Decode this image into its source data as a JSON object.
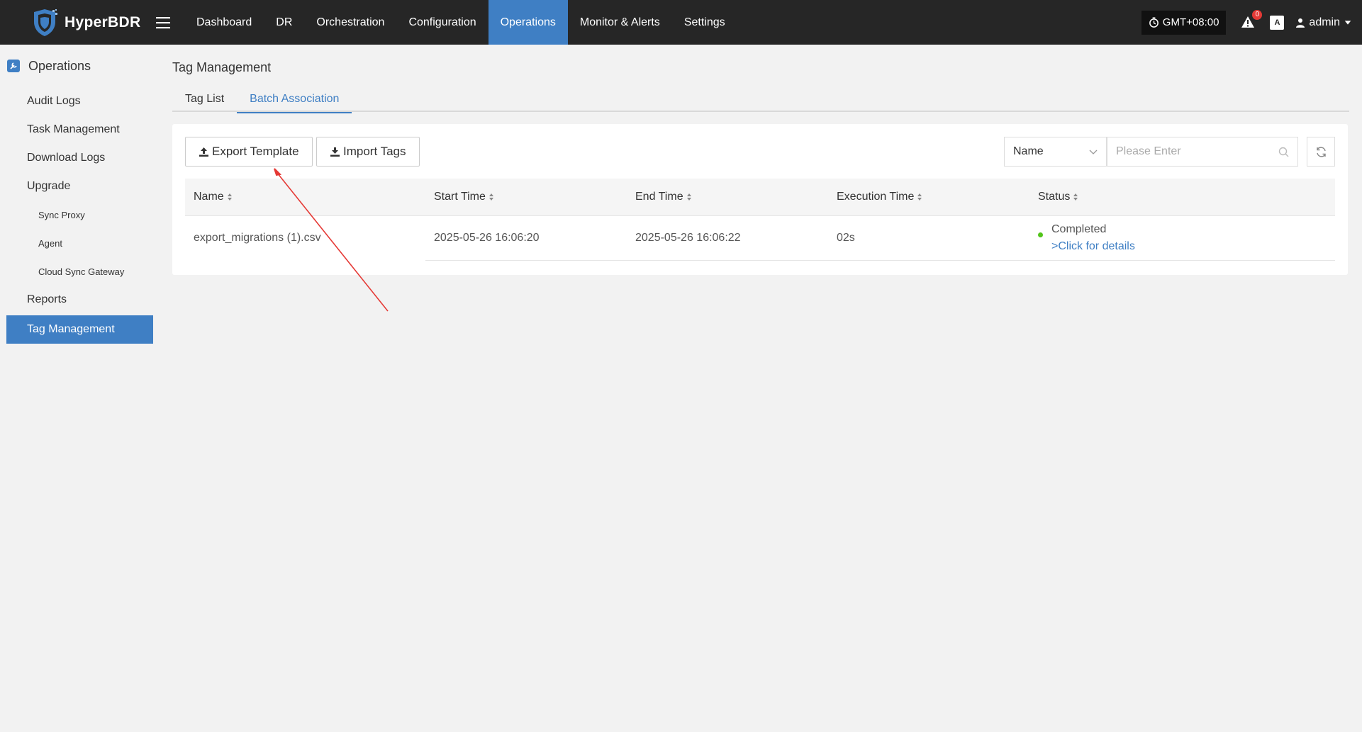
{
  "app": {
    "name": "HyperBDR"
  },
  "nav": {
    "items": [
      {
        "label": "Dashboard",
        "active": false
      },
      {
        "label": "DR",
        "active": false
      },
      {
        "label": "Orchestration",
        "active": false
      },
      {
        "label": "Configuration",
        "active": false
      },
      {
        "label": "Operations",
        "active": true
      },
      {
        "label": "Monitor & Alerts",
        "active": false
      },
      {
        "label": "Settings",
        "active": false
      }
    ],
    "timezone": "GMT+08:00",
    "alert_count": "0",
    "user": "admin",
    "accent_color": "#3f7fc4"
  },
  "sidebar": {
    "header": "Operations",
    "items": [
      {
        "label": "Audit Logs",
        "level": 1,
        "active": false
      },
      {
        "label": "Task Management",
        "level": 1,
        "active": false
      },
      {
        "label": "Download Logs",
        "level": 1,
        "active": false
      },
      {
        "label": "Upgrade",
        "level": 1,
        "active": false
      },
      {
        "label": "Sync Proxy",
        "level": 2,
        "active": false
      },
      {
        "label": "Agent",
        "level": 2,
        "active": false
      },
      {
        "label": "Cloud Sync Gateway",
        "level": 2,
        "active": false
      },
      {
        "label": "Reports",
        "level": 1,
        "active": false
      },
      {
        "label": "Tag Management",
        "level": 1,
        "active": true
      }
    ]
  },
  "main": {
    "title": "Tag Management",
    "tabs": [
      {
        "label": "Tag List",
        "active": false
      },
      {
        "label": "Batch Association",
        "active": true
      }
    ],
    "toolbar": {
      "export_label": "Export Template",
      "import_label": "Import Tags",
      "filter_field": "Name",
      "search_placeholder": "Please Enter"
    },
    "table": {
      "columns": [
        "Name",
        "Start Time",
        "End Time",
        "Execution Time",
        "Status"
      ],
      "rows": [
        {
          "name": "export_migrations (1).csv",
          "start_time": "2025-05-26 16:06:20",
          "end_time": "2025-05-26 16:06:22",
          "execution_time": "02s",
          "status": "Completed",
          "details_link": ">Click for details",
          "status_color": "#52c41a"
        }
      ]
    }
  },
  "annotation": {
    "arrow_color": "#e53935"
  }
}
